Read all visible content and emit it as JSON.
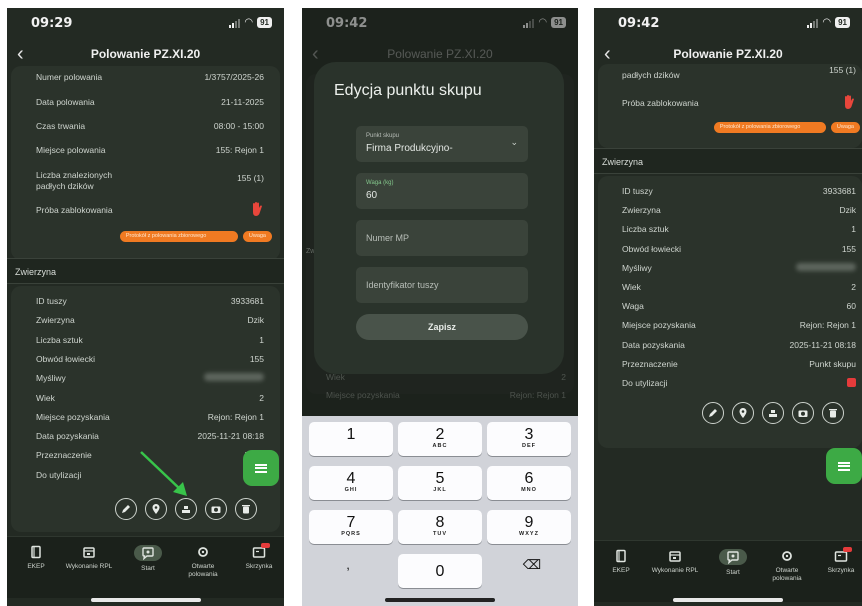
{
  "screen1": {
    "time": "09:29",
    "battery": "91",
    "title": "Polowanie PZ.XI.20",
    "hunt_rows": [
      {
        "label": "Numer polowania",
        "value": "1/3757/2025-26"
      },
      {
        "label": "Data polowania",
        "value": "21-11-2025"
      },
      {
        "label": "Czas trwania",
        "value": "08:00 - 15:00"
      },
      {
        "label": "Miejsce polowania",
        "value": "155: Rejon 1"
      },
      {
        "label": "Liczba znalezionych padłych dzików",
        "value": "155 (1)"
      },
      {
        "label": "Próba zablokowania",
        "value": ""
      }
    ],
    "tags": [
      "Protokół z polowania zbiorowego",
      "Uwaga"
    ],
    "section": "Zwierzyna",
    "animal_rows": [
      {
        "label": "ID tuszy",
        "value": "3933681"
      },
      {
        "label": "Zwierzyna",
        "value": "Dzik"
      },
      {
        "label": "Liczba sztuk",
        "value": "1"
      },
      {
        "label": "Obwód łowiecki",
        "value": "155"
      },
      {
        "label": "Myśliwy",
        "value": ""
      },
      {
        "label": "Wiek",
        "value": "2"
      },
      {
        "label": "Miejsce pozyskania",
        "value": "Rejon: Rejon 1"
      },
      {
        "label": "Data pozyskania",
        "value": "2025-11-21 08:18"
      },
      {
        "label": "Przeznaczenie",
        "value": "Punk"
      },
      {
        "label": "Do utylizacji",
        "value": ""
      }
    ]
  },
  "screen2": {
    "time": "09:42",
    "battery": "91",
    "title": "Polowanie PZ.XI.20",
    "dialog_title": "Edycja punktu skupu",
    "field_point_label": "Punkt skupu",
    "field_point_value": "Firma Produkcyjno-",
    "field_weight_label": "Waga (kg)",
    "field_weight_value": "60",
    "field_mp_placeholder": "Numer MP",
    "field_carcass_placeholder": "Identyfikator tuszy",
    "save_label": "Zapisz",
    "bg_rows": [
      {
        "label": "Wiek",
        "value": "2"
      },
      {
        "label": "Miejsce pozyskania",
        "value": "Rejon: Rejon 1"
      }
    ],
    "bg_partial": "Zw",
    "keys": [
      {
        "n": "1",
        "l": ""
      },
      {
        "n": "2",
        "l": "ABC"
      },
      {
        "n": "3",
        "l": "DEF"
      },
      {
        "n": "4",
        "l": "GHI"
      },
      {
        "n": "5",
        "l": "JKL"
      },
      {
        "n": "6",
        "l": "MNO"
      },
      {
        "n": "7",
        "l": "PQRS"
      },
      {
        "n": "8",
        "l": "TUV"
      },
      {
        "n": "9",
        "l": "WXYZ"
      },
      {
        "n": "0",
        "l": ""
      }
    ],
    "key_comma": ",",
    "key_delete": "⌫"
  },
  "screen3": {
    "time": "09:42",
    "battery": "91",
    "title": "Polowanie PZ.XI.20",
    "top_rows": [
      {
        "label": "padłych dzików",
        "value": "155 (1)"
      },
      {
        "label": "Próba zablokowania",
        "value": ""
      }
    ],
    "tags": [
      "Protokół z polowania zbiorowego",
      "Uwaga"
    ],
    "section": "Zwierzyna",
    "animal_rows": [
      {
        "label": "ID tuszy",
        "value": "3933681"
      },
      {
        "label": "Zwierzyna",
        "value": "Dzik"
      },
      {
        "label": "Liczba sztuk",
        "value": "1"
      },
      {
        "label": "Obwód łowiecki",
        "value": "155"
      },
      {
        "label": "Myśliwy",
        "value": ""
      },
      {
        "label": "Wiek",
        "value": "2"
      },
      {
        "label": "Waga",
        "value": "60"
      },
      {
        "label": "Miejsce pozyskania",
        "value": "Rejon: Rejon 1"
      },
      {
        "label": "Data pozyskania",
        "value": "2025-11-21 08:18"
      },
      {
        "label": "Przeznaczenie",
        "value": "Punkt skupu"
      },
      {
        "label": "Do utylizacji",
        "value": ""
      }
    ]
  },
  "tabs": [
    {
      "label": "EKEP",
      "icon": "book-icon"
    },
    {
      "label": "Wykonanie RPL",
      "icon": "calendar-icon"
    },
    {
      "label": "Start",
      "icon": "chat-icon"
    },
    {
      "label": "Otwarte polowania",
      "icon": "target-icon"
    },
    {
      "label": "Skrzynka",
      "icon": "inbox-icon"
    }
  ],
  "colors": {
    "background": "#232a23",
    "accent": "#3daa45",
    "tag": "#f07a22",
    "alert": "#e53b3b"
  }
}
